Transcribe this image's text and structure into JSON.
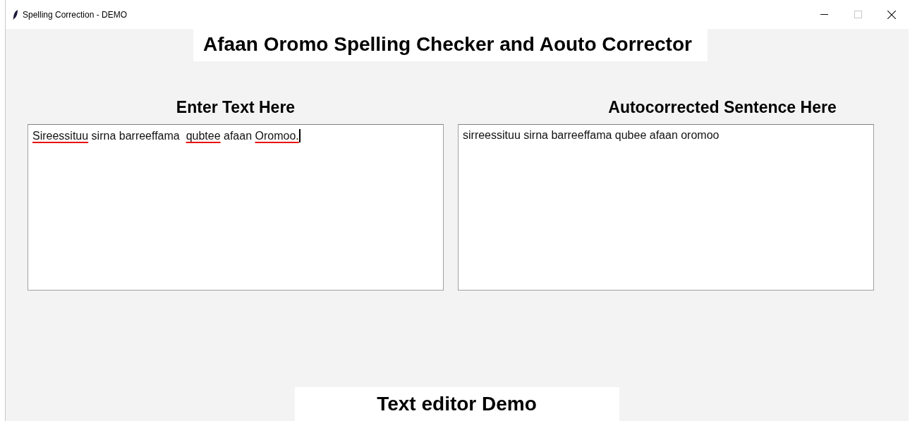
{
  "window": {
    "title": "Spelling Correction - DEMO",
    "controls": [
      {
        "kind": "minimize",
        "disabled": false
      },
      {
        "kind": "maximize",
        "disabled": true
      },
      {
        "kind": "close",
        "disabled": false
      }
    ]
  },
  "heading": "Afaan Oromo Spelling Checker and Aouto Corrector",
  "input_panel": {
    "label": "Enter Text Here",
    "focused": true,
    "words": [
      {
        "text": "Sireessituu",
        "misspelled": true
      },
      {
        "text": "sirna",
        "misspelled": false
      },
      {
        "text": "barreeffama ",
        "misspelled": false
      },
      {
        "text": "qubtee",
        "misspelled": true
      },
      {
        "text": "afaan",
        "misspelled": false
      },
      {
        "text": "Oromoo.",
        "misspelled": true
      }
    ]
  },
  "output_panel": {
    "label": "Autocorrected Sentence Here",
    "text": "sirreessituu sirna barreeffama qubee afaan oromoo"
  },
  "footer": "Text editor Demo"
}
